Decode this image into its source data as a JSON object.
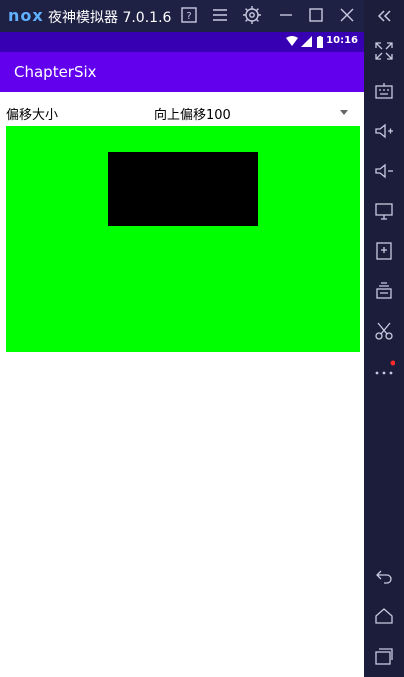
{
  "emulator": {
    "logo": "nox",
    "title": "夜神模拟器 7.0.1.6"
  },
  "status_bar": {
    "time": "10:16"
  },
  "app_bar": {
    "title": "ChapterSix"
  },
  "offset_row": {
    "label": "偏移大小",
    "selected_option": "向上偏移100"
  },
  "colors": {
    "app_bar": "#6200ee",
    "status_bar": "#3700b3",
    "canvas": "#00ff00",
    "rect": "#000000"
  }
}
